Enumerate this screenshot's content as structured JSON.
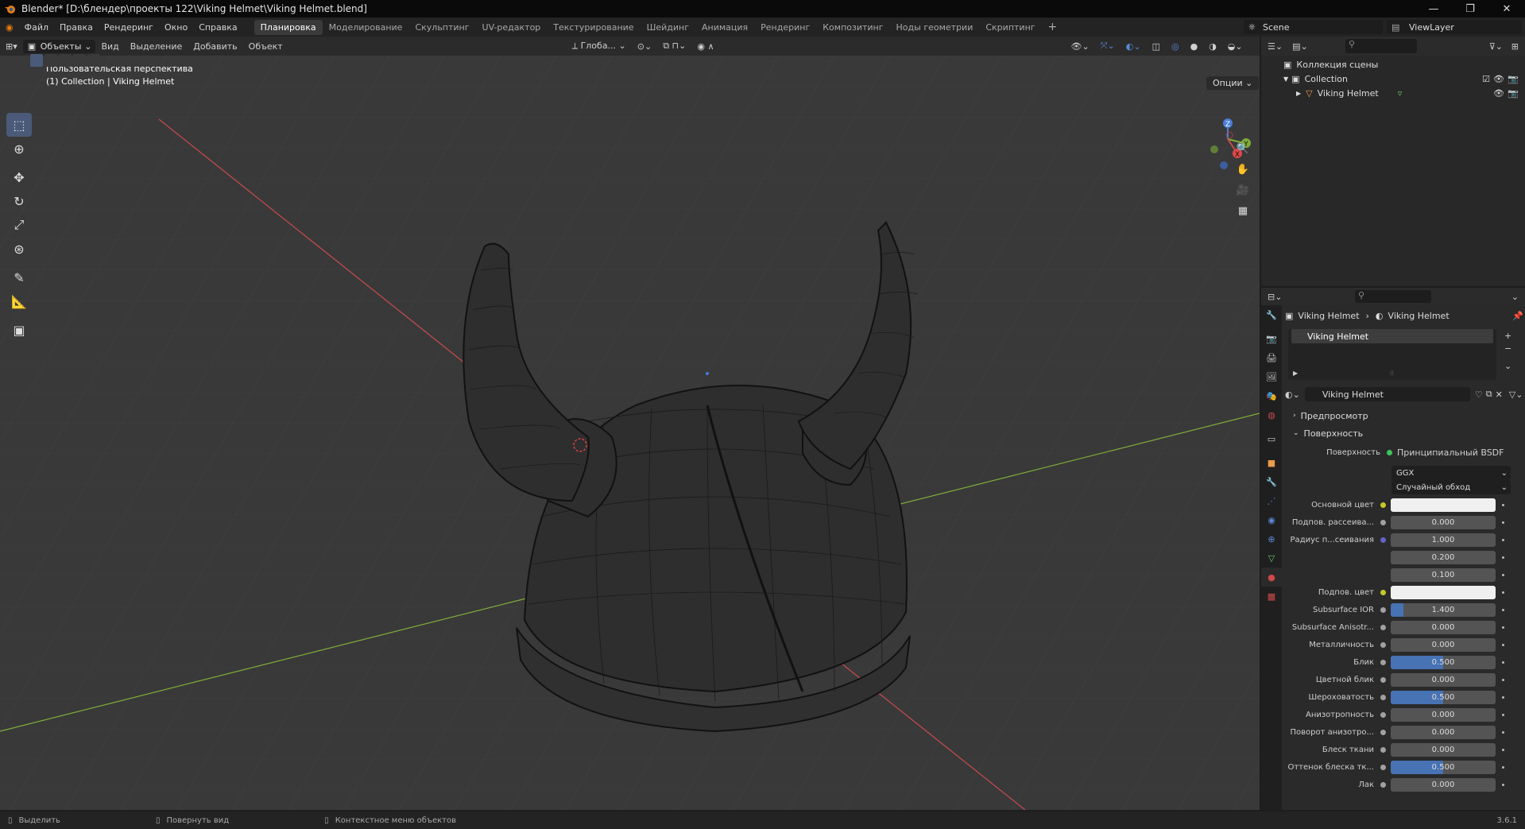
{
  "window": {
    "title": "Blender* [D:\\блендер\\проекты 122\\Viking Helmet\\Viking Helmet.blend]",
    "minimize": "—",
    "maximize": "❐",
    "close": "✕"
  },
  "menu": [
    "Файл",
    "Правка",
    "Рендеринг",
    "Окно",
    "Справка"
  ],
  "workspaces": [
    "Планировка",
    "Моделирование",
    "Скульптинг",
    "UV-редактор",
    "Текстурирование",
    "Шейдинг",
    "Анимация",
    "Рендеринг",
    "Композитинг",
    "Ноды геометрии",
    "Скриптинг"
  ],
  "workspace_add": "+",
  "scene": "Scene",
  "view_layer": "ViewLayer",
  "viewport": {
    "mode": "Объекты",
    "menu": [
      "Вид",
      "Выделение",
      "Добавить",
      "Объект"
    ],
    "orientation": "Глоба...",
    "options": "Опции",
    "perspective_text": "Пользовательская перспектива",
    "collection_text": "(1) Collection | Viking Helmet",
    "gizmo": {
      "x": "X",
      "y": "Y",
      "z": "Z"
    }
  },
  "outliner": {
    "root": "Коллекция сцены",
    "collection": "Collection",
    "object": "Viking Helmet"
  },
  "properties": {
    "crumb_object": "Viking Helmet",
    "crumb_material": "Viking Helmet",
    "slot_name": "Viking Helmet",
    "material_name": "Viking Helmet",
    "panel_preview": "Предпросмотр",
    "panel_surface": "Поверхность",
    "surface_label": "Поверхность",
    "surface_value": "Принципиальный BSDF",
    "distribution": "GGX",
    "subsurface_method": "Случайный обход",
    "rows": [
      {
        "label": "Основной цвет",
        "type": "color",
        "socket": "#c7c729"
      },
      {
        "label": "Подпов. рассеива...",
        "type": "value",
        "value": "0.000",
        "fill": 0,
        "socket": "#a1a1a1"
      },
      {
        "label": "Радиус п...сеивания",
        "type": "value",
        "value": "1.000",
        "fill": 0,
        "socket": "#6363c7"
      },
      {
        "label": "",
        "type": "value",
        "value": "0.200",
        "fill": 0,
        "socket": ""
      },
      {
        "label": "",
        "type": "value",
        "value": "0.100",
        "fill": 0,
        "socket": ""
      },
      {
        "label": "Подпов. цвет",
        "type": "color",
        "socket": "#c7c729"
      },
      {
        "label": "Subsurface IOR",
        "type": "value",
        "value": "1.400",
        "fill": 0.12,
        "socket": "#a1a1a1"
      },
      {
        "label": "Subsurface Anisotr...",
        "type": "value",
        "value": "0.000",
        "fill": 0,
        "socket": "#a1a1a1"
      },
      {
        "label": "Металличность",
        "type": "value",
        "value": "0.000",
        "fill": 0,
        "socket": "#a1a1a1"
      },
      {
        "label": "Блик",
        "type": "value",
        "value": "0.500",
        "fill": 0.5,
        "socket": "#a1a1a1"
      },
      {
        "label": "Цветной блик",
        "type": "value",
        "value": "0.000",
        "fill": 0,
        "socket": "#a1a1a1"
      },
      {
        "label": "Шероховатость",
        "type": "value",
        "value": "0.500",
        "fill": 0.5,
        "socket": "#a1a1a1"
      },
      {
        "label": "Анизотропность",
        "type": "value",
        "value": "0.000",
        "fill": 0,
        "socket": "#a1a1a1"
      },
      {
        "label": "Поворот анизотро...",
        "type": "value",
        "value": "0.000",
        "fill": 0,
        "socket": "#a1a1a1"
      },
      {
        "label": "Блеск ткани",
        "type": "value",
        "value": "0.000",
        "fill": 0,
        "socket": "#a1a1a1"
      },
      {
        "label": "Оттенок блеска тк...",
        "type": "value",
        "value": "0.500",
        "fill": 0.5,
        "socket": "#a1a1a1"
      },
      {
        "label": "Лак",
        "type": "value",
        "value": "0.000",
        "fill": 0,
        "socket": "#a1a1a1"
      }
    ]
  },
  "status": {
    "select": "Выделить",
    "rotate": "Повернуть вид",
    "context": "Контекстное меню объектов",
    "version": "3.6.1"
  },
  "colors": {
    "accent": "#4772b3",
    "selection": "#334d80",
    "x_axis": "#c84b4b",
    "y_axis": "#7fae3a",
    "z_axis": "#4a7fd8"
  }
}
